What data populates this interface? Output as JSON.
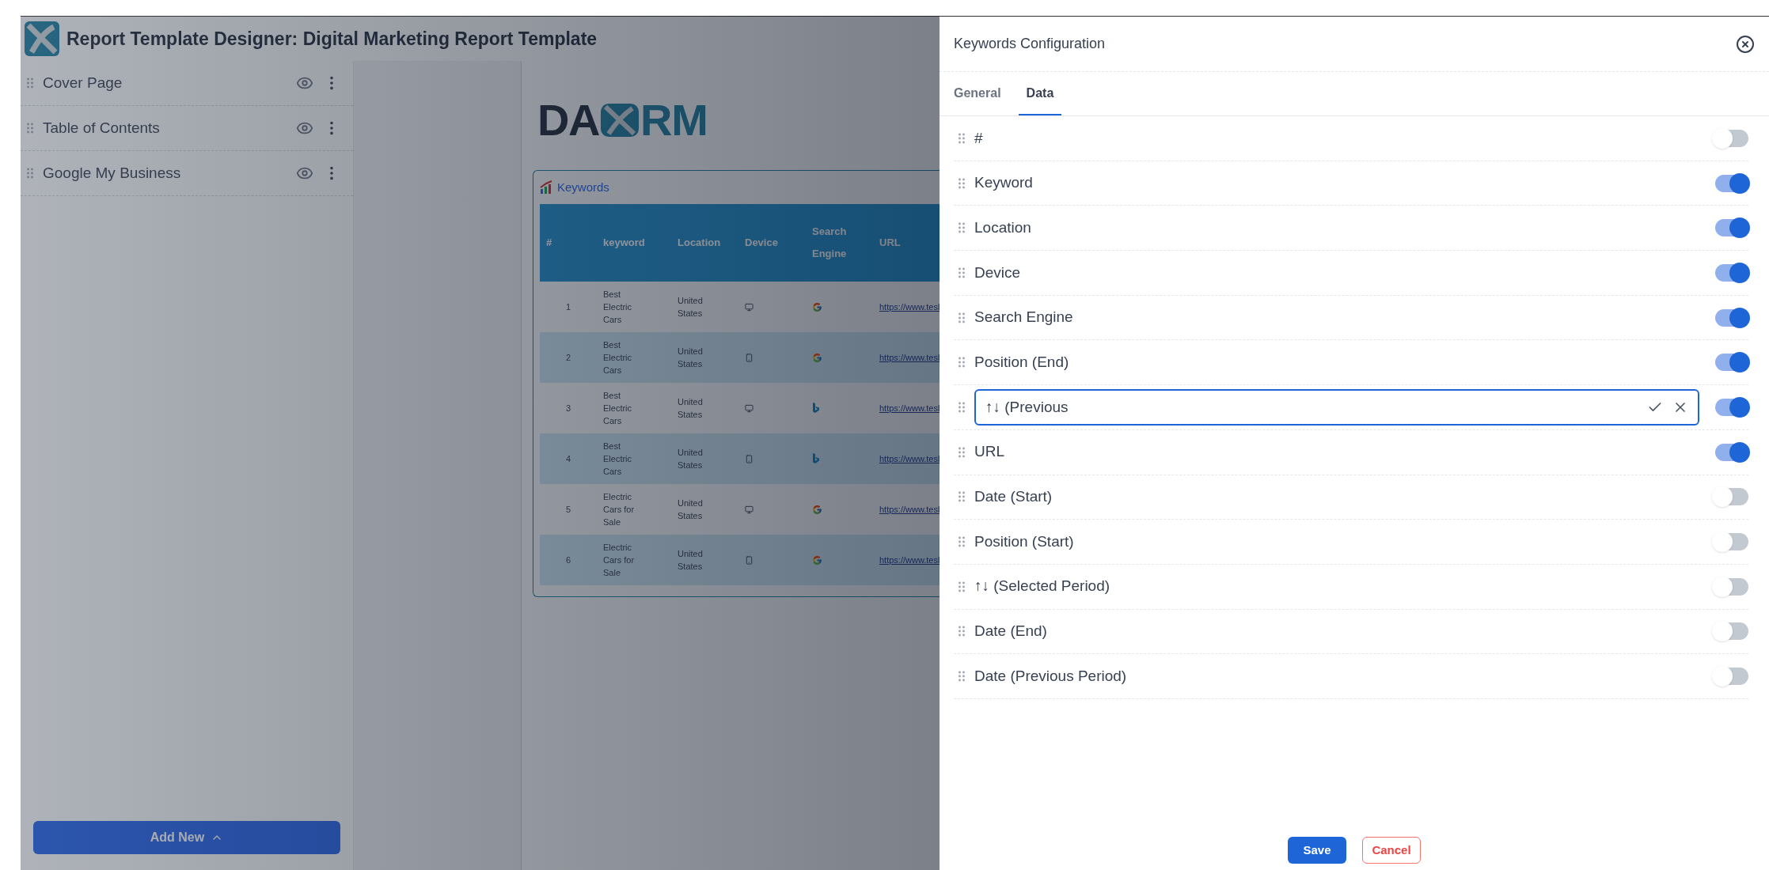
{
  "app": {
    "title": "Report Template Designer: Digital Marketing Report Template"
  },
  "sidebar": {
    "items": [
      {
        "label": "Cover Page"
      },
      {
        "label": "Table of Contents"
      },
      {
        "label": "Google My Business"
      }
    ],
    "add_button": "Add New"
  },
  "report": {
    "logo": {
      "left": "DA",
      "right": "RM"
    },
    "widget_title": "Keywords",
    "columns": [
      "#",
      "keyword",
      "Location",
      "Device",
      "Search Engine",
      "URL"
    ],
    "rows": [
      {
        "num": "1",
        "keyword": "Best Electric Cars",
        "location": "United States",
        "device": {
          "kind": "desktop"
        },
        "engine": {
          "kind": "google"
        },
        "url": "https://www.tesl"
      },
      {
        "num": "2",
        "keyword": "Best Electric Cars",
        "location": "United States",
        "device": {
          "kind": "mobile"
        },
        "engine": {
          "kind": "google"
        },
        "url": "https://www.tesl"
      },
      {
        "num": "3",
        "keyword": "Best Electric Cars",
        "location": "United States",
        "device": {
          "kind": "desktop"
        },
        "engine": {
          "kind": "bing"
        },
        "url": "https://www.tesl"
      },
      {
        "num": "4",
        "keyword": "Best Electric Cars",
        "location": "United States",
        "device": {
          "kind": "mobile"
        },
        "engine": {
          "kind": "bing"
        },
        "url": "https://www.tesl"
      },
      {
        "num": "5",
        "keyword": "Electric Cars for Sale",
        "location": "United States",
        "device": {
          "kind": "desktop"
        },
        "engine": {
          "kind": "google"
        },
        "url": "https://www.tesl"
      },
      {
        "num": "6",
        "keyword": "Electric Cars for Sale",
        "location": "United States",
        "device": {
          "kind": "mobile"
        },
        "engine": {
          "kind": "google"
        },
        "url": "https://www.tesl"
      }
    ]
  },
  "panel": {
    "title": "Keywords Configuration",
    "tabs": [
      {
        "label": "General",
        "selected": false
      },
      {
        "label": "Data",
        "selected": true
      }
    ],
    "fields": [
      {
        "kind": "text",
        "label": "#",
        "on": false
      },
      {
        "kind": "text",
        "label": "Keyword",
        "on": true
      },
      {
        "kind": "text",
        "label": "Location",
        "on": true
      },
      {
        "kind": "text",
        "label": "Device",
        "on": true
      },
      {
        "kind": "text",
        "label": "Search Engine",
        "on": true
      },
      {
        "kind": "text",
        "label": "Position (End)",
        "on": true
      },
      {
        "kind": "input",
        "label": "↑↓ (Previous",
        "on": true
      },
      {
        "kind": "text",
        "label": "URL",
        "on": true
      },
      {
        "kind": "text",
        "label": "Date (Start)",
        "on": false
      },
      {
        "kind": "text",
        "label": "Position (Start)",
        "on": false
      },
      {
        "kind": "text",
        "label": "↑↓ (Selected Period)",
        "on": false
      },
      {
        "kind": "text",
        "label": "Date (End)",
        "on": false
      },
      {
        "kind": "text",
        "label": "Date (Previous Period)",
        "on": false
      }
    ],
    "save": "Save",
    "cancel": "Cancel"
  }
}
